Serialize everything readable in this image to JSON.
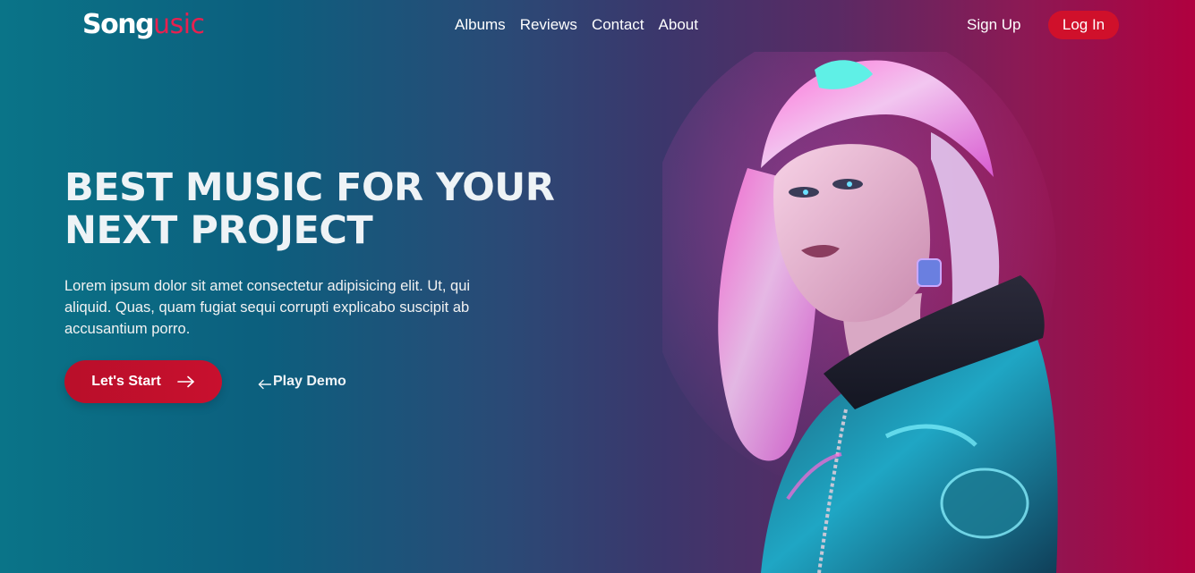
{
  "brand": {
    "logo_part1": "Song",
    "logo_part2": "usic"
  },
  "nav": {
    "items": [
      {
        "label": "Albums"
      },
      {
        "label": "Reviews"
      },
      {
        "label": "Contact"
      },
      {
        "label": "About"
      }
    ],
    "signup_label": "Sign Up",
    "login_label": "Log In"
  },
  "hero": {
    "headline": "BEST MUSIC FOR YOUR NEXT PROJECT",
    "body": "Lorem ipsum dolor sit amet consectetur adipisicing elit. Ut, qui aliquid. Quas, quam fugiat sequi corrupti explicabo suscipit ab accusantium porro.",
    "start_label": "Let's Start",
    "demo_label": "Play Demo"
  },
  "colors": {
    "accent": "#d0102b",
    "logo_accent": "#e8204f",
    "gradient_start": "#0a7488",
    "gradient_end": "#b0003f"
  },
  "icons": {
    "start_arrow": "arrow-right-icon",
    "demo_arrow": "arrow-left-icon"
  }
}
